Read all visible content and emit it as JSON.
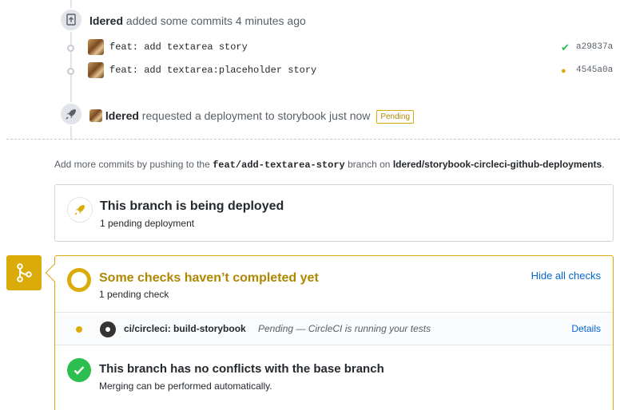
{
  "timeline": {
    "commits_event": {
      "actor": "ldered",
      "text": "added some commits 4 minutes ago"
    },
    "commits": [
      {
        "message": "feat: add textarea story",
        "status": "success",
        "sha": "a29837a"
      },
      {
        "message": "feat: add textarea:placeholder story",
        "status": "pending",
        "sha": "4545a0a"
      }
    ],
    "deploy_event": {
      "actor": "ldered",
      "text": "requested a deployment to storybook just now",
      "label": "Pending"
    }
  },
  "push_hint": {
    "prefix": "Add more commits by pushing to the",
    "branch": "feat/add-textarea-story",
    "middle": "branch on",
    "repo": "ldered/storybook-circleci-github-deployments",
    "suffix": "."
  },
  "deployment": {
    "title": "This branch is being deployed",
    "subtitle": "1 pending deployment"
  },
  "checks": {
    "title": "Some checks haven’t completed yet",
    "subtitle": "1 pending check",
    "toggle_label": "Hide all checks",
    "items": [
      {
        "name": "ci/circleci: build-storybook",
        "description": "Pending — CircleCI is running your tests",
        "details_label": "Details"
      }
    ]
  },
  "conflicts": {
    "title": "This branch has no conflicts with the base branch",
    "subtitle": "Merging can be performed automatically."
  },
  "colors": {
    "pending": "#dbab09",
    "success": "#2cbe4e",
    "link": "#0366d6"
  }
}
